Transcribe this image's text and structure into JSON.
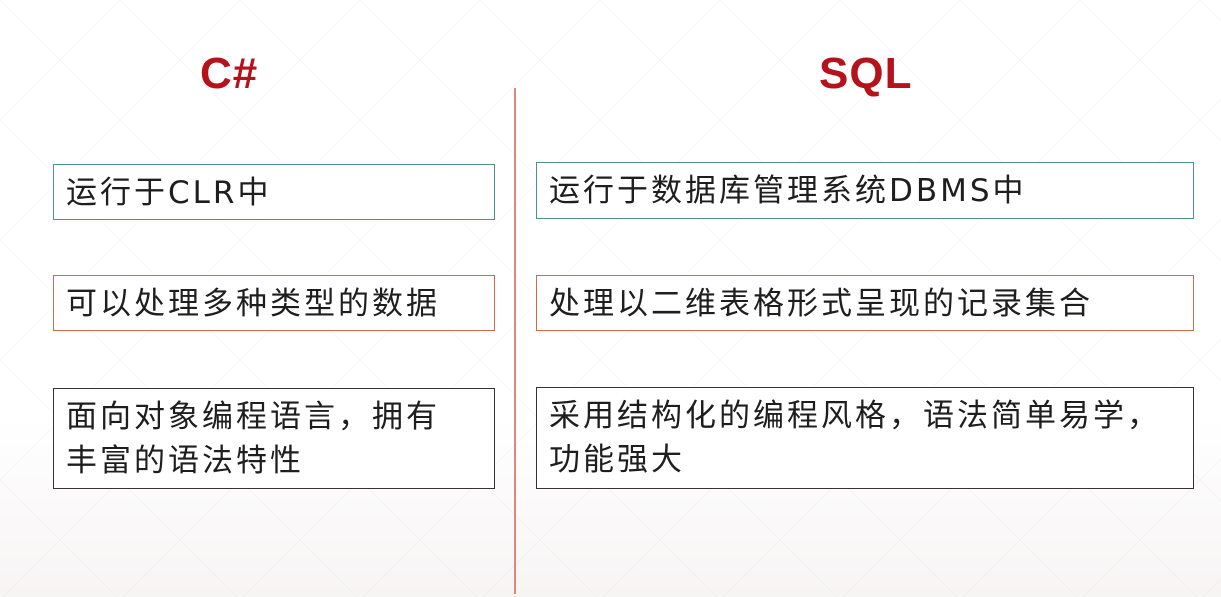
{
  "headings": {
    "left": "C#",
    "right": "SQL"
  },
  "left_column": {
    "item1": "运行于CLR中",
    "item2": "可以处理多种类型的数据",
    "item3_line1": "面向对象编程语言，拥有",
    "item3_line2": "丰富的语法特性"
  },
  "right_column": {
    "item1": "运行于数据库管理系统DBMS中",
    "item2": "处理以二维表格形式呈现的记录集合",
    "item3_line1": "采用结构化的编程风格，语法简单易学，",
    "item3_line2": "功能强大"
  },
  "colors": {
    "heading": "#b5121b",
    "divider": "#d98a7c",
    "teal_border": "#4f8f94",
    "orange_border": "#d06a4f",
    "black_border": "#333333"
  }
}
